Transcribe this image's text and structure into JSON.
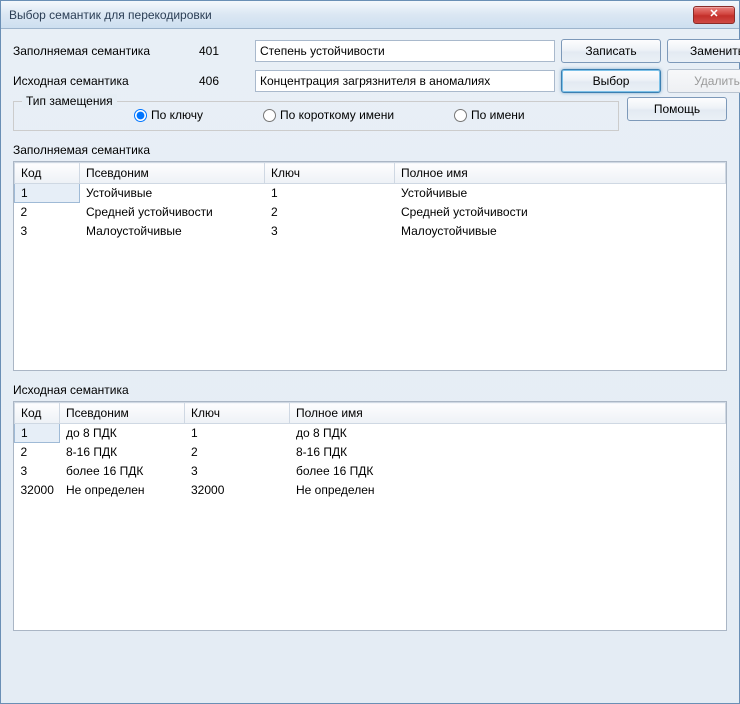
{
  "window": {
    "title": "Выбор семантик для перекодировки"
  },
  "form": {
    "fill_label": "Заполняемая семантика",
    "fill_code": "401",
    "fill_name": "Степень устойчивости",
    "src_label": "Исходная семантика",
    "src_code": "406",
    "src_name": "Концентрация загрязнителя в аномалиях"
  },
  "buttons": {
    "save": "Записать",
    "replace": "Заменить",
    "choose": "Выбор",
    "delete": "Удалить",
    "help": "Помощь"
  },
  "subst": {
    "legend": "Тип замещения",
    "by_key": "По ключу",
    "by_short": "По короткому имени",
    "by_name": "По имени"
  },
  "sections": {
    "fill": "Заполняемая семантика",
    "src": "Исходная семантика"
  },
  "cols": {
    "code": "Код",
    "alias": "Псевдоним",
    "key": "Ключ",
    "fullname": "Полное имя"
  },
  "fill_table": [
    {
      "code": "1",
      "alias": "Устойчивые",
      "key": "1",
      "fullname": "Устойчивые"
    },
    {
      "code": "2",
      "alias": "Средней устойчивости",
      "key": "2",
      "fullname": "Средней устойчивости"
    },
    {
      "code": "3",
      "alias": "Малоустойчивые",
      "key": "3",
      "fullname": "Малоустойчивые"
    }
  ],
  "src_table": [
    {
      "code": "1",
      "alias": "до 8 ПДК",
      "key": "1",
      "fullname": "до 8 ПДК"
    },
    {
      "code": "2",
      "alias": "8-16 ПДК",
      "key": "2",
      "fullname": "8-16 ПДК"
    },
    {
      "code": "3",
      "alias": "более 16 ПДК",
      "key": "3",
      "fullname": "более 16 ПДК"
    },
    {
      "code": "32000",
      "alias": "Не определен",
      "key": "32000",
      "fullname": "Не определен"
    }
  ]
}
